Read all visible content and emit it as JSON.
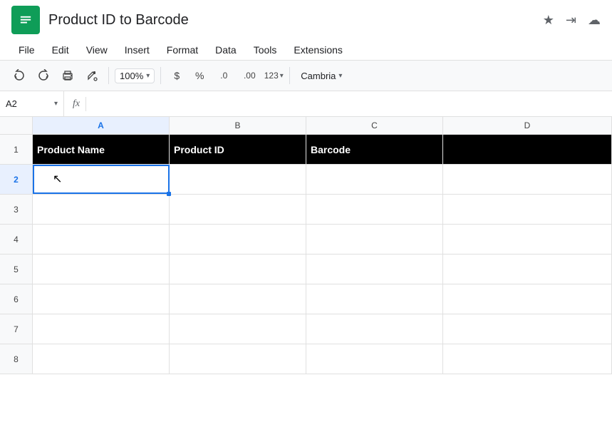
{
  "titleBar": {
    "appName": "Product ID to Barcode",
    "starIcon": "★",
    "moveIcon": "⇥",
    "cloudIcon": "☁"
  },
  "menuBar": {
    "items": [
      "File",
      "Edit",
      "View",
      "Insert",
      "Format",
      "Data",
      "Tools",
      "Extensions"
    ]
  },
  "toolbar": {
    "undoLabel": "↩",
    "redoLabel": "↪",
    "printLabel": "🖨",
    "paintLabel": "🪣",
    "zoom": "100%",
    "zoomArrow": "▾",
    "currencySymbol": "$",
    "percentSymbol": "%",
    "decDecimals": ".0",
    "incDecimals": ".00",
    "formatNum": "123",
    "fontName": "Cambria",
    "fontArrow": "▾"
  },
  "formulaBar": {
    "cellRef": "A2",
    "dropArrow": "▾",
    "fxLabel": "fx"
  },
  "columns": {
    "headers": [
      "A",
      "B",
      "C",
      "D"
    ],
    "widths": [
      192,
      192,
      192,
      null
    ]
  },
  "rows": [
    {
      "num": "1",
      "cells": [
        "Product Name",
        "Product ID",
        "Barcode",
        ""
      ]
    },
    {
      "num": "2",
      "cells": [
        "",
        "",
        "",
        ""
      ]
    },
    {
      "num": "3",
      "cells": [
        "",
        "",
        "",
        ""
      ]
    },
    {
      "num": "4",
      "cells": [
        "",
        "",
        "",
        ""
      ]
    },
    {
      "num": "5",
      "cells": [
        "",
        "",
        "",
        ""
      ]
    },
    {
      "num": "6",
      "cells": [
        "",
        "",
        "",
        ""
      ]
    },
    {
      "num": "7",
      "cells": [
        "",
        "",
        "",
        ""
      ]
    },
    {
      "num": "8",
      "cells": [
        "",
        "",
        "",
        ""
      ]
    }
  ]
}
